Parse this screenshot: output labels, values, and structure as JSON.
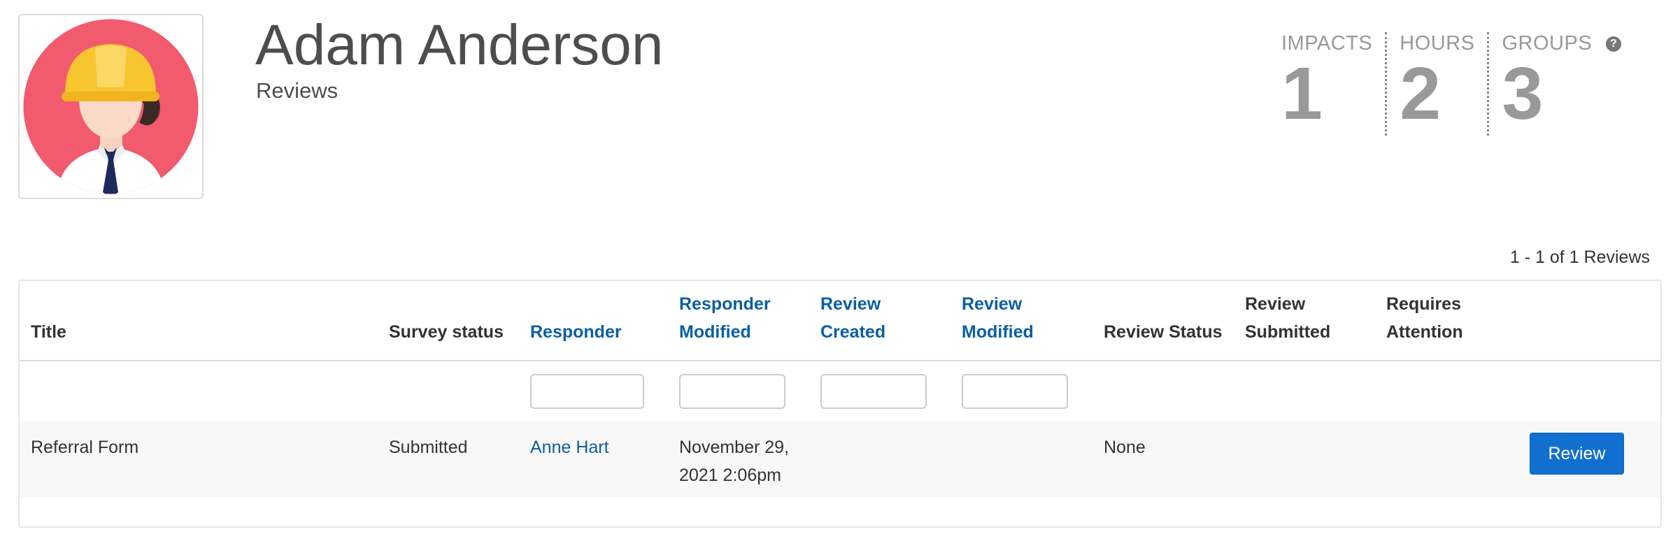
{
  "profile": {
    "name": "Adam Anderson",
    "subtitle": "Reviews",
    "avatar_icon": "worker-hardhat-avatar"
  },
  "stats": [
    {
      "label": "IMPACTS",
      "value": "1"
    },
    {
      "label": "HOURS",
      "value": "2"
    },
    {
      "label": "GROUPS",
      "value": "3",
      "help": true
    }
  ],
  "pagination": {
    "text": "1 - 1 of 1 Reviews"
  },
  "table": {
    "headers": {
      "title": "Title",
      "survey_status": "Survey status",
      "responder": "Responder",
      "responder_modified": "Responder Modified",
      "review_created": "Review Created",
      "review_modified": "Review Modified",
      "review_status": "Review Status",
      "review_submitted": "Review Submitted",
      "requires_attention": "Requires Attention"
    },
    "rows": [
      {
        "title": "Referral Form",
        "survey_status": "Submitted",
        "responder": "Anne Hart",
        "responder_modified": "November 29, 2021 2:06pm",
        "review_created": "",
        "review_modified": "",
        "review_status": "None",
        "review_submitted": "",
        "requires_attention": "",
        "action_label": "Review"
      }
    ]
  },
  "colors": {
    "link": "#0b5fa0",
    "button": "#1170cf",
    "avatar_bg": "#f25a6e",
    "hardhat": "#f7c530"
  }
}
